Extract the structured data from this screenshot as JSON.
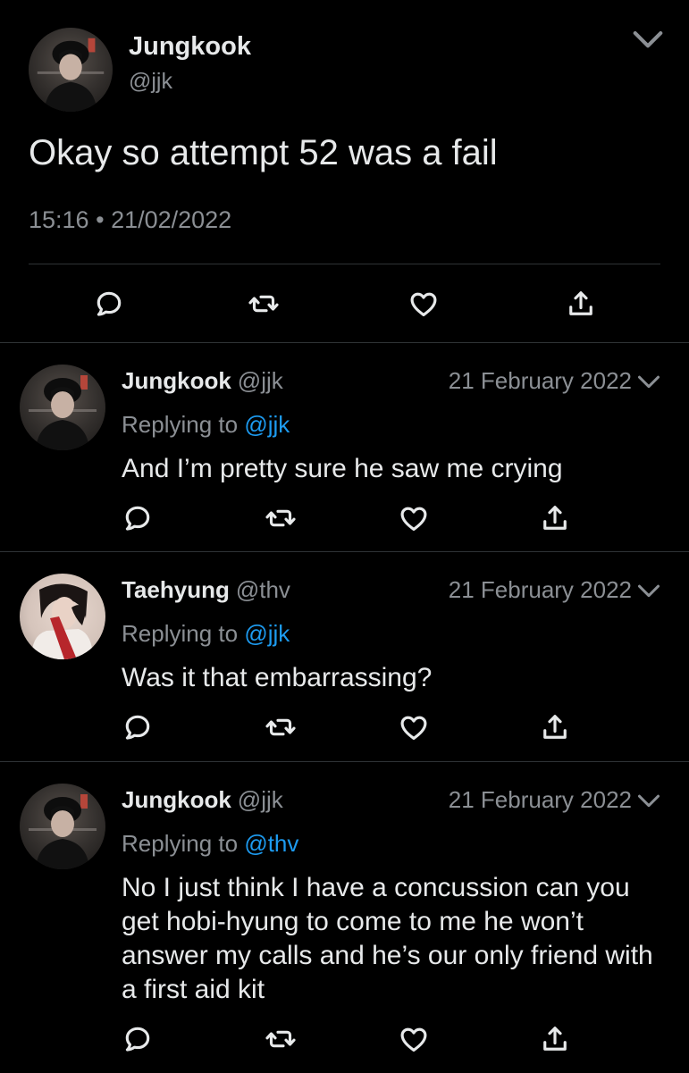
{
  "main_tweet": {
    "author_name": "Jungkook",
    "author_handle": "@jjk",
    "text": "Okay so attempt 52 was a fail",
    "time": "15:16",
    "separator": "•",
    "date": "21/02/2022"
  },
  "replies": [
    {
      "author_name": "Jungkook",
      "author_handle": "@jjk",
      "date": "21 February 2022",
      "replying_label": "Replying to",
      "replying_to": "@jjk",
      "text": "And I’m pretty sure he saw me crying"
    },
    {
      "author_name": "Taehyung",
      "author_handle": "@thv",
      "date": "21 February 2022",
      "replying_label": "Replying to",
      "replying_to": "@jjk",
      "text": "Was it that embarrassing?"
    },
    {
      "author_name": "Jungkook",
      "author_handle": "@jjk",
      "date": "21 February 2022",
      "replying_label": "Replying to",
      "replying_to": "@thv",
      "text": "No I just think I have a concussion can you get hobi-hyung to come to me he won’t answer my calls and he’s our only friend with a first aid kit"
    }
  ],
  "icons": {
    "reply": "reply-icon",
    "retweet": "retweet-icon",
    "like": "heart-icon",
    "share": "share-icon",
    "more": "chevron-down-icon"
  },
  "colors": {
    "background": "#000000",
    "text": "#e7e9ea",
    "muted": "#8b8f94",
    "link": "#1d9bf0",
    "divider": "#2f3336"
  }
}
